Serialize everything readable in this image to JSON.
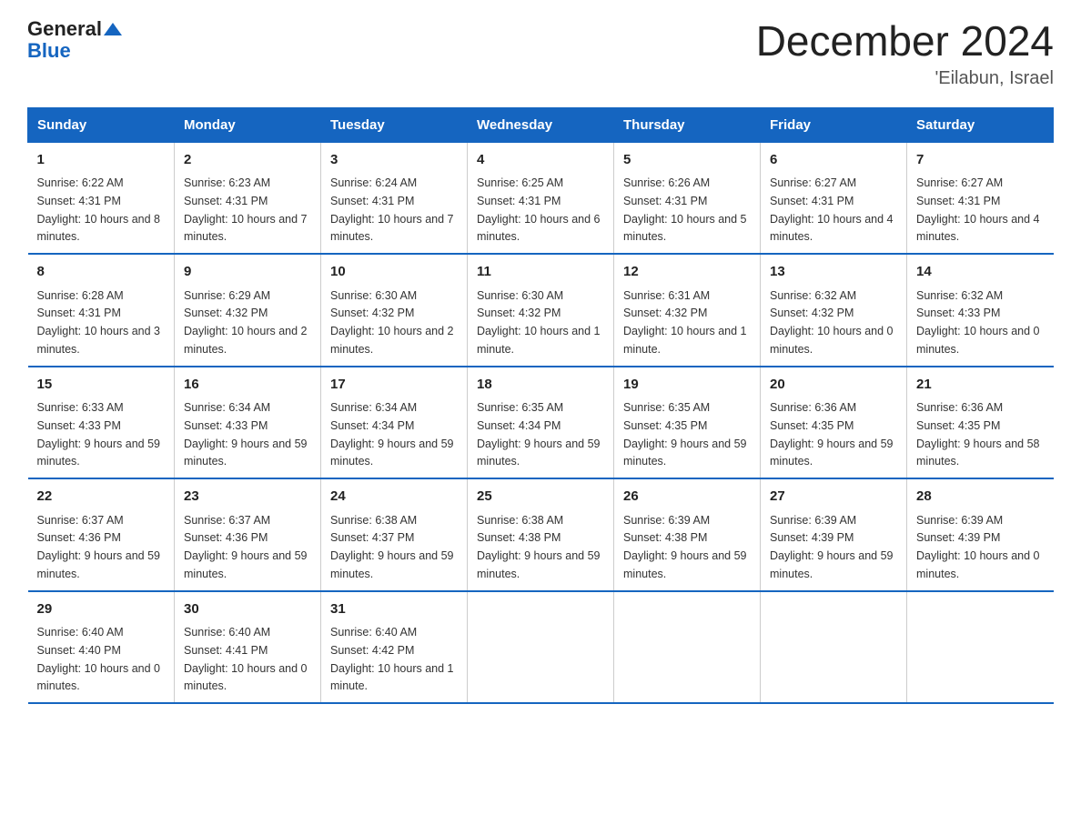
{
  "header": {
    "logo_line1": "General",
    "logo_line2": "Blue",
    "title": "December 2024",
    "subtitle": "'Eilabun, Israel"
  },
  "days_of_week": [
    "Sunday",
    "Monday",
    "Tuesday",
    "Wednesday",
    "Thursday",
    "Friday",
    "Saturday"
  ],
  "weeks": [
    [
      {
        "day": "1",
        "sunrise": "6:22 AM",
        "sunset": "4:31 PM",
        "daylight": "10 hours and 8 minutes."
      },
      {
        "day": "2",
        "sunrise": "6:23 AM",
        "sunset": "4:31 PM",
        "daylight": "10 hours and 7 minutes."
      },
      {
        "day": "3",
        "sunrise": "6:24 AM",
        "sunset": "4:31 PM",
        "daylight": "10 hours and 7 minutes."
      },
      {
        "day": "4",
        "sunrise": "6:25 AM",
        "sunset": "4:31 PM",
        "daylight": "10 hours and 6 minutes."
      },
      {
        "day": "5",
        "sunrise": "6:26 AM",
        "sunset": "4:31 PM",
        "daylight": "10 hours and 5 minutes."
      },
      {
        "day": "6",
        "sunrise": "6:27 AM",
        "sunset": "4:31 PM",
        "daylight": "10 hours and 4 minutes."
      },
      {
        "day": "7",
        "sunrise": "6:27 AM",
        "sunset": "4:31 PM",
        "daylight": "10 hours and 4 minutes."
      }
    ],
    [
      {
        "day": "8",
        "sunrise": "6:28 AM",
        "sunset": "4:31 PM",
        "daylight": "10 hours and 3 minutes."
      },
      {
        "day": "9",
        "sunrise": "6:29 AM",
        "sunset": "4:32 PM",
        "daylight": "10 hours and 2 minutes."
      },
      {
        "day": "10",
        "sunrise": "6:30 AM",
        "sunset": "4:32 PM",
        "daylight": "10 hours and 2 minutes."
      },
      {
        "day": "11",
        "sunrise": "6:30 AM",
        "sunset": "4:32 PM",
        "daylight": "10 hours and 1 minute."
      },
      {
        "day": "12",
        "sunrise": "6:31 AM",
        "sunset": "4:32 PM",
        "daylight": "10 hours and 1 minute."
      },
      {
        "day": "13",
        "sunrise": "6:32 AM",
        "sunset": "4:32 PM",
        "daylight": "10 hours and 0 minutes."
      },
      {
        "day": "14",
        "sunrise": "6:32 AM",
        "sunset": "4:33 PM",
        "daylight": "10 hours and 0 minutes."
      }
    ],
    [
      {
        "day": "15",
        "sunrise": "6:33 AM",
        "sunset": "4:33 PM",
        "daylight": "9 hours and 59 minutes."
      },
      {
        "day": "16",
        "sunrise": "6:34 AM",
        "sunset": "4:33 PM",
        "daylight": "9 hours and 59 minutes."
      },
      {
        "day": "17",
        "sunrise": "6:34 AM",
        "sunset": "4:34 PM",
        "daylight": "9 hours and 59 minutes."
      },
      {
        "day": "18",
        "sunrise": "6:35 AM",
        "sunset": "4:34 PM",
        "daylight": "9 hours and 59 minutes."
      },
      {
        "day": "19",
        "sunrise": "6:35 AM",
        "sunset": "4:35 PM",
        "daylight": "9 hours and 59 minutes."
      },
      {
        "day": "20",
        "sunrise": "6:36 AM",
        "sunset": "4:35 PM",
        "daylight": "9 hours and 59 minutes."
      },
      {
        "day": "21",
        "sunrise": "6:36 AM",
        "sunset": "4:35 PM",
        "daylight": "9 hours and 58 minutes."
      }
    ],
    [
      {
        "day": "22",
        "sunrise": "6:37 AM",
        "sunset": "4:36 PM",
        "daylight": "9 hours and 59 minutes."
      },
      {
        "day": "23",
        "sunrise": "6:37 AM",
        "sunset": "4:36 PM",
        "daylight": "9 hours and 59 minutes."
      },
      {
        "day": "24",
        "sunrise": "6:38 AM",
        "sunset": "4:37 PM",
        "daylight": "9 hours and 59 minutes."
      },
      {
        "day": "25",
        "sunrise": "6:38 AM",
        "sunset": "4:38 PM",
        "daylight": "9 hours and 59 minutes."
      },
      {
        "day": "26",
        "sunrise": "6:39 AM",
        "sunset": "4:38 PM",
        "daylight": "9 hours and 59 minutes."
      },
      {
        "day": "27",
        "sunrise": "6:39 AM",
        "sunset": "4:39 PM",
        "daylight": "9 hours and 59 minutes."
      },
      {
        "day": "28",
        "sunrise": "6:39 AM",
        "sunset": "4:39 PM",
        "daylight": "10 hours and 0 minutes."
      }
    ],
    [
      {
        "day": "29",
        "sunrise": "6:40 AM",
        "sunset": "4:40 PM",
        "daylight": "10 hours and 0 minutes."
      },
      {
        "day": "30",
        "sunrise": "6:40 AM",
        "sunset": "4:41 PM",
        "daylight": "10 hours and 0 minutes."
      },
      {
        "day": "31",
        "sunrise": "6:40 AM",
        "sunset": "4:42 PM",
        "daylight": "10 hours and 1 minute."
      },
      null,
      null,
      null,
      null
    ]
  ],
  "labels": {
    "sunrise_prefix": "Sunrise: ",
    "sunset_prefix": "Sunset: ",
    "daylight_prefix": "Daylight: "
  }
}
